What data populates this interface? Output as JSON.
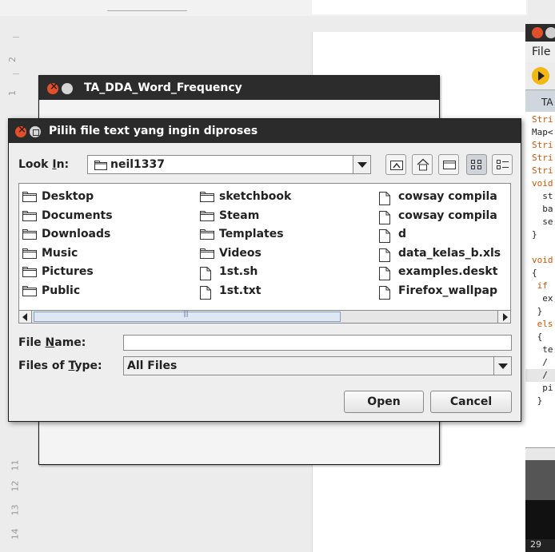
{
  "ruler": {
    "numbers": [
      "2",
      "1",
      "11",
      "12",
      "13",
      "14"
    ]
  },
  "ide": {
    "menu_label": "File",
    "tab_label": "TA",
    "code_lines": [
      "Stri",
      "Map<",
      "Stri",
      "Stri",
      "Stri",
      "void",
      "  st",
      "  ba",
      "  se",
      "}",
      "",
      "void",
      "{",
      " if",
      "  ex",
      " }",
      " els",
      " {",
      "  te",
      "  /",
      "  /",
      "  pi",
      " }"
    ],
    "status": "29"
  },
  "word_frequency_window": {
    "title": "TA_DDA_Word_Frequency"
  },
  "dialog": {
    "title": "Pilih file text yang ingin diproses",
    "look_in": {
      "label_pre": "Look ",
      "label_mn": "I",
      "label_post": "n:",
      "value": "neil1337"
    },
    "columns": [
      [
        {
          "name": "Desktop",
          "type": "folder"
        },
        {
          "name": "Documents",
          "type": "folder"
        },
        {
          "name": "Downloads",
          "type": "folder"
        },
        {
          "name": "Music",
          "type": "folder"
        },
        {
          "name": "Pictures",
          "type": "folder"
        },
        {
          "name": "Public",
          "type": "folder"
        }
      ],
      [
        {
          "name": "sketchbook",
          "type": "folder"
        },
        {
          "name": "Steam",
          "type": "folder"
        },
        {
          "name": "Templates",
          "type": "folder"
        },
        {
          "name": "Videos",
          "type": "folder"
        },
        {
          "name": "1st.sh",
          "type": "file"
        },
        {
          "name": "1st.txt",
          "type": "file"
        }
      ],
      [
        {
          "name": "cowsay compila",
          "type": "file"
        },
        {
          "name": "cowsay compila",
          "type": "file"
        },
        {
          "name": "d",
          "type": "file"
        },
        {
          "name": "data_kelas_b.xls",
          "type": "file"
        },
        {
          "name": "examples.deskt",
          "type": "file"
        },
        {
          "name": "Firefox_wallpap",
          "type": "file"
        }
      ]
    ],
    "file_name": {
      "label_pre": "File ",
      "label_mn": "N",
      "label_post": "ame:",
      "value": ""
    },
    "files_of_type": {
      "label_pre": "Files of ",
      "label_mn": "T",
      "label_post": "ype:",
      "value": "All Files"
    },
    "buttons": {
      "open": "Open",
      "cancel": "Cancel"
    }
  },
  "icons": {
    "toolbar": [
      "up-folder-icon",
      "home-icon",
      "new-folder-icon",
      "list-view-icon",
      "details-view-icon"
    ]
  }
}
